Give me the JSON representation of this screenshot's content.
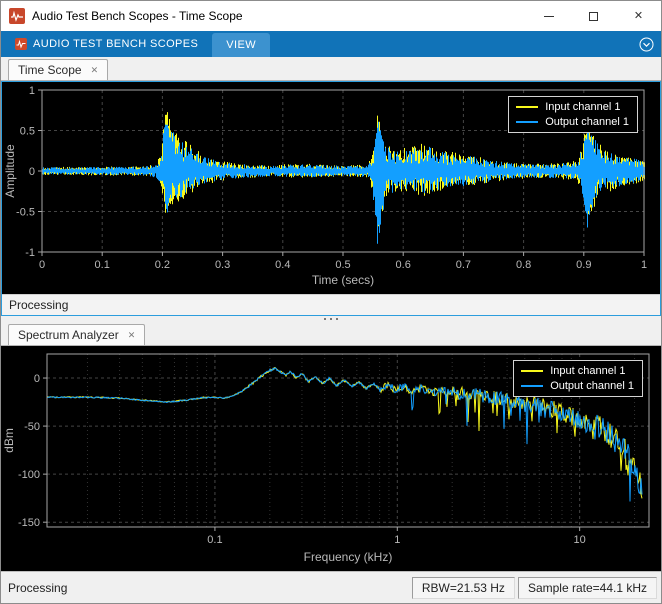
{
  "window": {
    "title": "Audio Test Bench Scopes - Time Scope"
  },
  "icons": {
    "tab_close": "✕",
    "window_close": "✕"
  },
  "toolstrip": {
    "tabs": [
      {
        "label": "AUDIO TEST BENCH SCOPES"
      },
      {
        "label": "VIEW"
      }
    ]
  },
  "panels": [
    {
      "tab": "Time Scope",
      "status": "Processing"
    },
    {
      "tab": "Spectrum Analyzer",
      "status": "Processing",
      "status_right": [
        "RBW=21.53 Hz",
        "Sample rate=44.1 kHz"
      ]
    }
  ],
  "colors": {
    "toolstrip_blue": "#1173b8",
    "focus_border": "#2c9ddd",
    "scope_background": "#000000",
    "grid_line": "#454545",
    "axis_text": "#b9b9b9",
    "channel1_yellow": "#f8f81c",
    "channel2_blue": "#139fff"
  },
  "chart_data": [
    {
      "id": "time_scope",
      "type": "line",
      "title": "",
      "xlabel": "Time (secs)",
      "ylabel": "Amplitude",
      "xlim": [
        0,
        1
      ],
      "ylim": [
        -1,
        1
      ],
      "xticks": [
        0,
        0.1,
        0.2,
        0.3,
        0.4,
        0.5,
        0.6,
        0.7,
        0.8,
        0.9,
        1
      ],
      "yticks": [
        1,
        0.5,
        0,
        -0.5,
        -1
      ],
      "grid": true,
      "legend_position": "top-right",
      "envelope_note": "audio waveform bursts as [time_secs, +peak, -peak]; noise fills the envelope",
      "series": [
        {
          "name": "Input channel 1",
          "color": "#f8f81c",
          "envelope": [
            [
              0,
              0.05,
              0.05
            ],
            [
              0.17,
              0.06,
              0.06
            ],
            [
              0.19,
              0.09,
              0.09
            ],
            [
              0.198,
              0.3,
              0.25
            ],
            [
              0.205,
              0.88,
              0.62
            ],
            [
              0.212,
              0.62,
              0.5
            ],
            [
              0.22,
              0.5,
              0.42
            ],
            [
              0.235,
              0.4,
              0.34
            ],
            [
              0.25,
              0.3,
              0.27
            ],
            [
              0.27,
              0.2,
              0.17
            ],
            [
              0.3,
              0.13,
              0.12
            ],
            [
              0.33,
              0.09,
              0.09
            ],
            [
              0.38,
              0.07,
              0.07
            ],
            [
              0.43,
              0.1,
              0.09
            ],
            [
              0.46,
              0.08,
              0.08
            ],
            [
              0.5,
              0.07,
              0.07
            ],
            [
              0.54,
              0.08,
              0.08
            ],
            [
              0.551,
              0.3,
              0.3
            ],
            [
              0.557,
              0.78,
              0.8
            ],
            [
              0.563,
              0.5,
              0.55
            ],
            [
              0.572,
              0.32,
              0.3
            ],
            [
              0.59,
              0.27,
              0.25
            ],
            [
              0.615,
              0.3,
              0.28
            ],
            [
              0.635,
              0.36,
              0.32
            ],
            [
              0.655,
              0.28,
              0.26
            ],
            [
              0.68,
              0.24,
              0.22
            ],
            [
              0.71,
              0.2,
              0.19
            ],
            [
              0.74,
              0.15,
              0.15
            ],
            [
              0.78,
              0.1,
              0.1
            ],
            [
              0.82,
              0.09,
              0.09
            ],
            [
              0.86,
              0.1,
              0.1
            ],
            [
              0.888,
              0.13,
              0.12
            ],
            [
              0.897,
              0.35,
              0.3
            ],
            [
              0.905,
              0.66,
              0.6
            ],
            [
              0.913,
              0.48,
              0.52
            ],
            [
              0.925,
              0.34,
              0.34
            ],
            [
              0.94,
              0.26,
              0.26
            ],
            [
              0.96,
              0.2,
              0.2
            ],
            [
              0.98,
              0.17,
              0.17
            ],
            [
              1,
              0.13,
              0.13
            ]
          ]
        },
        {
          "name": "Output channel 1",
          "color": "#139fff",
          "envelope": [
            [
              0,
              0.045,
              0.045
            ],
            [
              0.17,
              0.055,
              0.055
            ],
            [
              0.19,
              0.085,
              0.085
            ],
            [
              0.198,
              0.28,
              0.22
            ],
            [
              0.205,
              0.78,
              0.55
            ],
            [
              0.212,
              0.55,
              0.45
            ],
            [
              0.22,
              0.45,
              0.38
            ],
            [
              0.235,
              0.36,
              0.3
            ],
            [
              0.25,
              0.27,
              0.24
            ],
            [
              0.27,
              0.18,
              0.15
            ],
            [
              0.3,
              0.12,
              0.11
            ],
            [
              0.33,
              0.085,
              0.085
            ],
            [
              0.38,
              0.065,
              0.065
            ],
            [
              0.43,
              0.09,
              0.085
            ],
            [
              0.46,
              0.075,
              0.075
            ],
            [
              0.5,
              0.065,
              0.065
            ],
            [
              0.54,
              0.075,
              0.075
            ],
            [
              0.551,
              0.32,
              0.4
            ],
            [
              0.557,
              0.72,
              1.0
            ],
            [
              0.563,
              0.46,
              0.62
            ],
            [
              0.572,
              0.3,
              0.32
            ],
            [
              0.59,
              0.25,
              0.24
            ],
            [
              0.615,
              0.28,
              0.26
            ],
            [
              0.635,
              0.33,
              0.3
            ],
            [
              0.655,
              0.26,
              0.24
            ],
            [
              0.68,
              0.22,
              0.21
            ],
            [
              0.71,
              0.19,
              0.18
            ],
            [
              0.74,
              0.14,
              0.14
            ],
            [
              0.78,
              0.095,
              0.095
            ],
            [
              0.82,
              0.085,
              0.085
            ],
            [
              0.86,
              0.095,
              0.095
            ],
            [
              0.888,
              0.12,
              0.11
            ],
            [
              0.897,
              0.32,
              0.3
            ],
            [
              0.905,
              0.6,
              0.72
            ],
            [
              0.913,
              0.44,
              0.5
            ],
            [
              0.925,
              0.32,
              0.32
            ],
            [
              0.94,
              0.24,
              0.24
            ],
            [
              0.96,
              0.19,
              0.19
            ],
            [
              0.98,
              0.16,
              0.16
            ],
            [
              1,
              0.12,
              0.12
            ]
          ]
        }
      ]
    },
    {
      "id": "spectrum_analyzer",
      "type": "line",
      "title": "",
      "xlabel": "Frequency (kHz)",
      "ylabel": "dBm",
      "xscale": "log",
      "xlim": [
        0.012,
        24
      ],
      "ylim": [
        -155,
        25
      ],
      "xticks": [
        0.1,
        1,
        10
      ],
      "yticks": [
        0,
        -50,
        -100,
        -150
      ],
      "grid": true,
      "legend_position": "top-right",
      "points_note": "shared mean spectrum [freq_kHz, dBm]; both channels overlay this curve with noise spikes at high frequency",
      "points": [
        [
          0.012,
          -20
        ],
        [
          0.02,
          -20
        ],
        [
          0.03,
          -21
        ],
        [
          0.04,
          -23
        ],
        [
          0.055,
          -25
        ],
        [
          0.07,
          -23
        ],
        [
          0.085,
          -20.5
        ],
        [
          0.1,
          -20
        ],
        [
          0.112,
          -21
        ],
        [
          0.125,
          -19
        ],
        [
          0.14,
          -14
        ],
        [
          0.16,
          -6
        ],
        [
          0.18,
          2
        ],
        [
          0.2,
          8
        ],
        [
          0.215,
          10
        ],
        [
          0.23,
          6
        ],
        [
          0.245,
          3
        ],
        [
          0.26,
          7
        ],
        [
          0.28,
          0
        ],
        [
          0.3,
          5
        ],
        [
          0.325,
          -4
        ],
        [
          0.355,
          2
        ],
        [
          0.39,
          -6
        ],
        [
          0.425,
          0
        ],
        [
          0.465,
          -8
        ],
        [
          0.51,
          -2
        ],
        [
          0.56,
          -9
        ],
        [
          0.615,
          -4
        ],
        [
          0.675,
          -11
        ],
        [
          0.74,
          -6
        ],
        [
          0.81,
          -12
        ],
        [
          0.89,
          -7
        ],
        [
          0.98,
          -13
        ],
        [
          1.08,
          -9
        ],
        [
          1.2,
          -14
        ],
        [
          1.35,
          -11
        ],
        [
          1.55,
          -15
        ],
        [
          1.8,
          -13
        ],
        [
          2.1,
          -17
        ],
        [
          2.5,
          -15
        ],
        [
          3,
          -19
        ],
        [
          3.6,
          -21
        ],
        [
          4.3,
          -24
        ],
        [
          5.2,
          -27
        ],
        [
          6.2,
          -31
        ],
        [
          7.4,
          -34
        ],
        [
          8.6,
          -38
        ],
        [
          10,
          -43
        ],
        [
          11.5,
          -48
        ],
        [
          13,
          -53
        ],
        [
          14.5,
          -58
        ],
        [
          16,
          -65
        ],
        [
          17.5,
          -74
        ],
        [
          19,
          -88
        ],
        [
          20.5,
          -102
        ],
        [
          21.5,
          -112
        ],
        [
          22.05,
          -118
        ]
      ],
      "series": [
        {
          "name": "Input channel 1",
          "color": "#f8f81c"
        },
        {
          "name": "Output channel 1",
          "color": "#139fff"
        }
      ]
    }
  ]
}
